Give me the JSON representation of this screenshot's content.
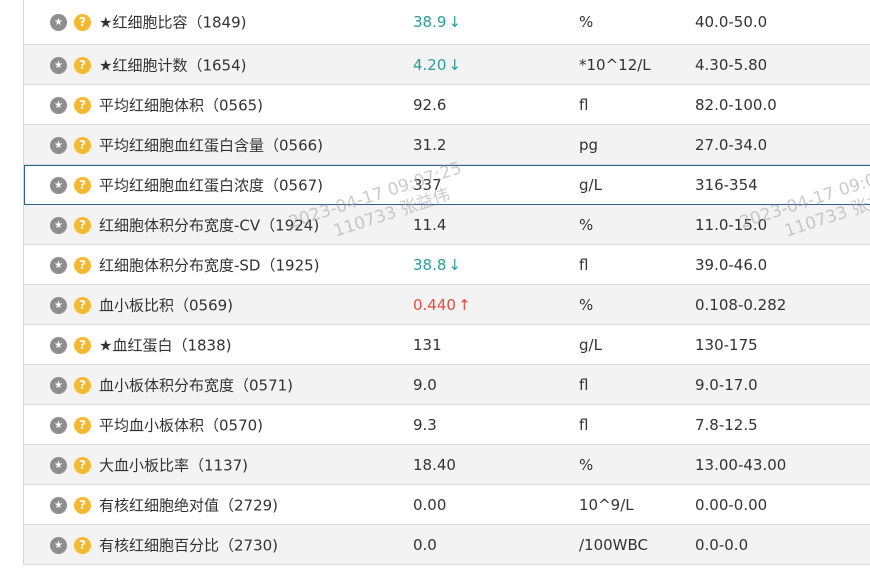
{
  "icons": {
    "star": "star-icon",
    "help": "question-icon"
  },
  "colors": {
    "low": "#2a9d9a",
    "high": "#e74c3c",
    "help_badge": "#f5b82e",
    "star_badge": "#8e8e8e"
  },
  "rows": [
    {
      "name": "★红细胞比容（1849)",
      "value": "38.9",
      "flag": "↓",
      "unit": "%",
      "range": "40.0-50.0"
    },
    {
      "name": "★红细胞计数（1654)",
      "value": "4.20",
      "flag": "↓",
      "unit": "*10^12/L",
      "range": "4.30-5.80"
    },
    {
      "name": "平均红细胞体积（0565)",
      "value": "92.6",
      "flag": "",
      "unit": "fl",
      "range": "82.0-100.0"
    },
    {
      "name": "平均红细胞血红蛋白含量（0566)",
      "value": "31.2",
      "flag": "",
      "unit": "pg",
      "range": "27.0-34.0"
    },
    {
      "name": "平均红细胞血红蛋白浓度（0567)",
      "value": "337",
      "flag": "",
      "unit": "g/L",
      "range": "316-354"
    },
    {
      "name": "红细胞体积分布宽度-CV（1924)",
      "value": "11.4",
      "flag": "",
      "unit": "%",
      "range": "11.0-15.0"
    },
    {
      "name": "红细胞体积分布宽度-SD（1925)",
      "value": "38.8",
      "flag": "↓",
      "unit": "fl",
      "range": "39.0-46.0"
    },
    {
      "name": "血小板比积（0569)",
      "value": "0.440",
      "flag": "↑",
      "unit": "%",
      "range": "0.108-0.282"
    },
    {
      "name": "★血红蛋白（1838)",
      "value": "131",
      "flag": "",
      "unit": "g/L",
      "range": "130-175"
    },
    {
      "name": "血小板体积分布宽度（0571)",
      "value": "9.0",
      "flag": "",
      "unit": "fl",
      "range": "9.0-17.0"
    },
    {
      "name": "平均血小板体积（0570)",
      "value": "9.3",
      "flag": "",
      "unit": "fl",
      "range": "7.8-12.5"
    },
    {
      "name": "大血小板比率（1137)",
      "value": "18.40",
      "flag": "",
      "unit": "%",
      "range": "13.00-43.00"
    },
    {
      "name": "有核红细胞绝对值（2729)",
      "value": "0.00",
      "flag": "",
      "unit": "10^9/L",
      "range": "0.00-0.00"
    },
    {
      "name": "有核红细胞百分比（2730)",
      "value": "0.0",
      "flag": "",
      "unit": "/100WBC",
      "range": "0.0-0.0"
    }
  ],
  "watermark": {
    "line1": "2023-04-17 09:07:25",
    "line2": "110733 张益伟"
  }
}
